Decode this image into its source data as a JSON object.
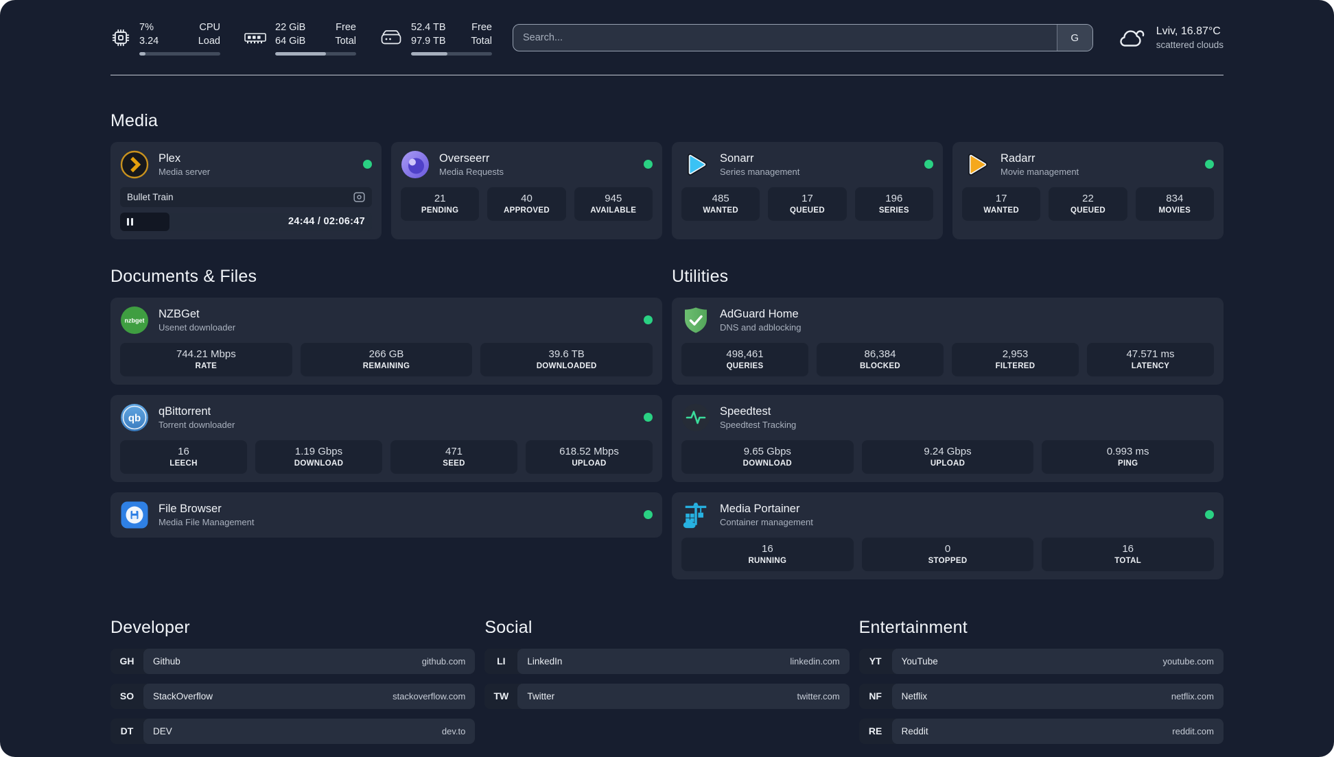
{
  "topbar": {
    "widgets": [
      {
        "icon": "cpu-icon",
        "values": [
          "7%",
          "3.24"
        ],
        "labels": [
          "CPU",
          "Load"
        ],
        "progress": 8
      },
      {
        "icon": "ram-icon",
        "values": [
          "22 GiB",
          "64 GiB"
        ],
        "labels": [
          "Free",
          "Total"
        ],
        "progress": 63
      },
      {
        "icon": "disk-icon",
        "values": [
          "52.4 TB",
          "97.9 TB"
        ],
        "labels": [
          "Free",
          "Total"
        ],
        "progress": 45
      }
    ],
    "search": {
      "placeholder": "Search...",
      "button": "G"
    },
    "weather": {
      "icon": "cloud-icon",
      "location": "Lviv, 16.87°C",
      "condition": "scattered clouds"
    }
  },
  "sections": {
    "media": {
      "title": "Media",
      "cards": [
        {
          "icon": "plex-icon",
          "name": "Plex",
          "subtitle": "Media server",
          "online": true,
          "player": {
            "title": "Bullet Train",
            "time": "24:44 / 02:06:47",
            "progress": 19.5
          }
        },
        {
          "icon": "overseerr-icon",
          "name": "Overseerr",
          "subtitle": "Media Requests",
          "online": true,
          "stats": [
            {
              "value": "21",
              "label": "PENDING"
            },
            {
              "value": "40",
              "label": "APPROVED"
            },
            {
              "value": "945",
              "label": "AVAILABLE"
            }
          ]
        },
        {
          "icon": "sonarr-icon",
          "name": "Sonarr",
          "subtitle": "Series management",
          "online": true,
          "stats": [
            {
              "value": "485",
              "label": "WANTED"
            },
            {
              "value": "17",
              "label": "QUEUED"
            },
            {
              "value": "196",
              "label": "SERIES"
            }
          ]
        },
        {
          "icon": "radarr-icon",
          "name": "Radarr",
          "subtitle": "Movie management",
          "online": true,
          "stats": [
            {
              "value": "17",
              "label": "WANTED"
            },
            {
              "value": "22",
              "label": "QUEUED"
            },
            {
              "value": "834",
              "label": "MOVIES"
            }
          ]
        }
      ]
    },
    "documents": {
      "title": "Documents & Files",
      "cards": [
        {
          "icon": "nzbget-icon",
          "name": "NZBGet",
          "subtitle": "Usenet downloader",
          "online": true,
          "stats": [
            {
              "value": "744.21 Mbps",
              "label": "RATE"
            },
            {
              "value": "266 GB",
              "label": "REMAINING"
            },
            {
              "value": "39.6 TB",
              "label": "DOWNLOADED"
            }
          ]
        },
        {
          "icon": "qbittorrent-icon",
          "name": "qBittorrent",
          "subtitle": "Torrent downloader",
          "online": true,
          "stats": [
            {
              "value": "16",
              "label": "LEECH"
            },
            {
              "value": "1.19 Gbps",
              "label": "DOWNLOAD"
            },
            {
              "value": "471",
              "label": "SEED"
            },
            {
              "value": "618.52 Mbps",
              "label": "UPLOAD"
            }
          ]
        },
        {
          "icon": "filebrowser-icon",
          "name": "File Browser",
          "subtitle": "Media File Management",
          "online": true
        }
      ]
    },
    "utilities": {
      "title": "Utilities",
      "cards": [
        {
          "icon": "adguard-icon",
          "name": "AdGuard Home",
          "subtitle": "DNS and adblocking",
          "online": false,
          "stats": [
            {
              "value": "498,461",
              "label": "QUERIES"
            },
            {
              "value": "86,384",
              "label": "BLOCKED"
            },
            {
              "value": "2,953",
              "label": "FILTERED"
            },
            {
              "value": "47.571 ms",
              "label": "LATENCY"
            }
          ]
        },
        {
          "icon": "speedtest-icon",
          "name": "Speedtest",
          "subtitle": "Speedtest Tracking",
          "online": false,
          "stats": [
            {
              "value": "9.65 Gbps",
              "label": "DOWNLOAD"
            },
            {
              "value": "9.24 Gbps",
              "label": "UPLOAD"
            },
            {
              "value": "0.993 ms",
              "label": "PING"
            }
          ]
        },
        {
          "icon": "portainer-icon",
          "name": "Media Portainer",
          "subtitle": "Container management",
          "online": true,
          "stats": [
            {
              "value": "16",
              "label": "RUNNING"
            },
            {
              "value": "0",
              "label": "STOPPED"
            },
            {
              "value": "16",
              "label": "TOTAL"
            }
          ]
        }
      ]
    }
  },
  "bookmarks": [
    {
      "title": "Developer",
      "items": [
        {
          "abbr": "GH",
          "name": "Github",
          "domain": "github.com"
        },
        {
          "abbr": "SO",
          "name": "StackOverflow",
          "domain": "stackoverflow.com"
        },
        {
          "abbr": "DT",
          "name": "DEV",
          "domain": "dev.to"
        }
      ]
    },
    {
      "title": "Social",
      "items": [
        {
          "abbr": "LI",
          "name": "LinkedIn",
          "domain": "linkedin.com"
        },
        {
          "abbr": "TW",
          "name": "Twitter",
          "domain": "twitter.com"
        }
      ]
    },
    {
      "title": "Entertainment",
      "items": [
        {
          "abbr": "YT",
          "name": "YouTube",
          "domain": "youtube.com"
        },
        {
          "abbr": "NF",
          "name": "Netflix",
          "domain": "netflix.com"
        },
        {
          "abbr": "RE",
          "name": "Reddit",
          "domain": "reddit.com"
        }
      ]
    }
  ],
  "colors": {
    "online": "#2AD183",
    "background": "#171E2F",
    "card": "#242B3B",
    "accent_plex": "#E5A00D"
  }
}
